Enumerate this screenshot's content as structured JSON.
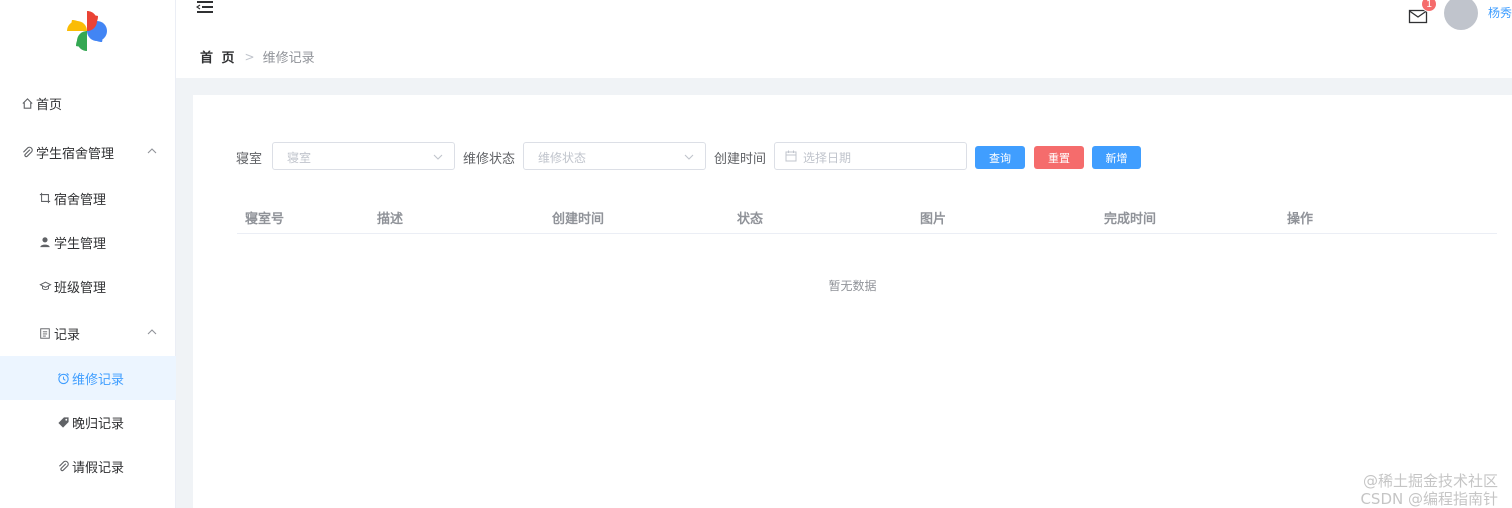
{
  "sidebar": {
    "items": [
      {
        "label": "首页",
        "icon": "home-icon"
      },
      {
        "label": "学生宿舍管理",
        "icon": "paperclip-icon"
      },
      {
        "label": "宿舍管理",
        "icon": "crop-icon"
      },
      {
        "label": "学生管理",
        "icon": "user-icon"
      },
      {
        "label": "班级管理",
        "icon": "graduation-cap-icon"
      },
      {
        "label": "记录",
        "icon": "document-icon"
      },
      {
        "label": "维修记录",
        "icon": "alarm-clock-icon"
      },
      {
        "label": "晚归记录",
        "icon": "tag-icon"
      },
      {
        "label": "请假记录",
        "icon": "paperclip-icon"
      }
    ]
  },
  "header": {
    "breadcrumb_home": "首 页",
    "breadcrumb_separator": ">",
    "breadcrumb_current": "维修记录",
    "notification_count": "1",
    "username": "杨秀"
  },
  "search": {
    "room_label": "寝室",
    "room_placeholder": "寝室",
    "status_label": "维修状态",
    "status_placeholder": "维修状态",
    "created_label": "创建时间",
    "date_placeholder": "选择日期",
    "query_button": "查询",
    "reset_button": "重置",
    "add_button": "新增"
  },
  "table": {
    "columns": [
      "寝室号",
      "描述",
      "创建时间",
      "状态",
      "图片",
      "完成时间",
      "操作"
    ],
    "rows": [],
    "empty_text": "暂无数据"
  },
  "watermark": {
    "line1": "@稀土掘金技术社区",
    "line2": "CSDN @编程指南针"
  },
  "colors": {
    "primary": "#409eff",
    "danger": "#f56c6c",
    "active_bg": "#ecf5ff"
  }
}
